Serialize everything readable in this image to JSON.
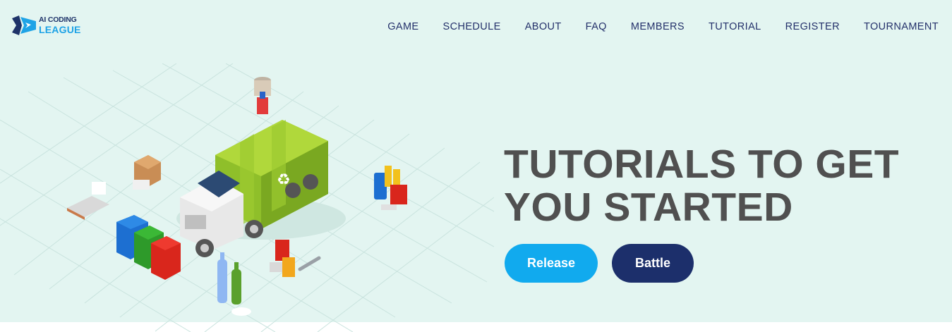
{
  "brand": {
    "line1": "AI CODING",
    "line2": "LEAGUE",
    "colors": {
      "navy": "#1e3369",
      "blue": "#1ea3e6"
    }
  },
  "nav": {
    "items": [
      "GAME",
      "SCHEDULE",
      "ABOUT",
      "FAQ",
      "MEMBERS",
      "TUTORIAL",
      "REGISTER",
      "TOURNAMENT"
    ]
  },
  "hero": {
    "headline_line1": "TUTORIALS TO GET",
    "headline_line2": "YOU STARTED",
    "buttons": {
      "release_label": "Release",
      "battle_label": "Battle"
    },
    "colors": {
      "background": "#e3f5f1",
      "release": "#11aaee",
      "battle": "#1c2f6b",
      "heading": "#505050"
    }
  },
  "illustration": {
    "subject": "garbage-truck-recycling-scene",
    "icons": [
      "garbage-truck-icon",
      "recycle-bin-blue-icon",
      "recycle-bin-green-icon",
      "recycle-bin-red-icon",
      "battery-icon",
      "bottle-icon",
      "can-icon",
      "box-icon",
      "wrench-icon",
      "cup-icon"
    ]
  }
}
